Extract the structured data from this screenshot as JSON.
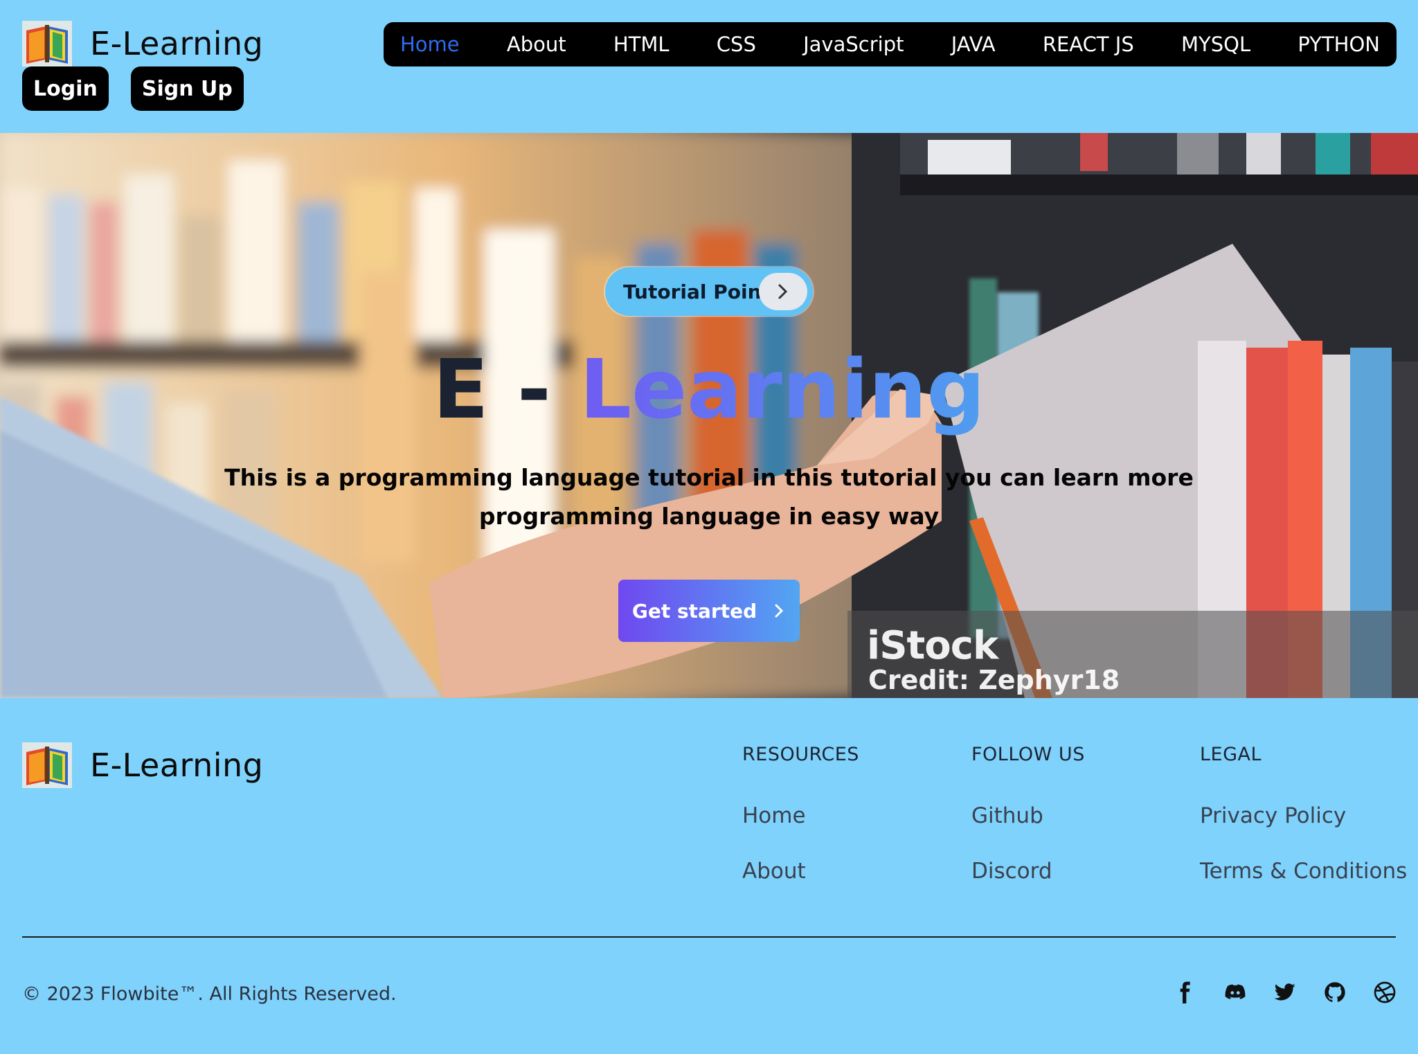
{
  "brand": {
    "name": "E-Learning"
  },
  "auth": {
    "login_label": "Login",
    "signup_label": "Sign Up"
  },
  "nav": {
    "items": [
      {
        "label": "Home",
        "active": true
      },
      {
        "label": "About"
      },
      {
        "label": "HTML"
      },
      {
        "label": "CSS"
      },
      {
        "label": "JavaScript"
      },
      {
        "label": "JAVA"
      },
      {
        "label": "REACT JS"
      },
      {
        "label": "MYSQL"
      },
      {
        "label": "PYTHON"
      }
    ]
  },
  "hero": {
    "pill_label": "Tutorial Point",
    "title_prefix": "E - ",
    "title_highlight": "Learning",
    "description": "This is a programming language tutorial in this tutorial you can learn more programming language in easy way",
    "cta_label": "Get started",
    "watermark": {
      "brand": "iStock",
      "credit": "Credit: Zephyr18"
    }
  },
  "footer": {
    "brand_name": "E-Learning",
    "columns": [
      {
        "title": "RESOURCES",
        "links": [
          "Home",
          "About"
        ]
      },
      {
        "title": "FOLLOW US",
        "links": [
          "Github",
          "Discord"
        ]
      },
      {
        "title": "LEGAL",
        "links": [
          "Privacy Policy",
          "Terms & Conditions"
        ]
      }
    ],
    "copyright": "© 2023 Flowbite™. All Rights Reserved.",
    "socials": [
      "facebook-icon",
      "discord-icon",
      "twitter-icon",
      "github-icon",
      "dribbble-icon"
    ]
  },
  "colors": {
    "page_background": "#7fd2fb",
    "nav_background": "#000000",
    "nav_active": "#2f6cf0",
    "gradient_start": "#6f48f0",
    "gradient_end": "#52a6f2"
  }
}
